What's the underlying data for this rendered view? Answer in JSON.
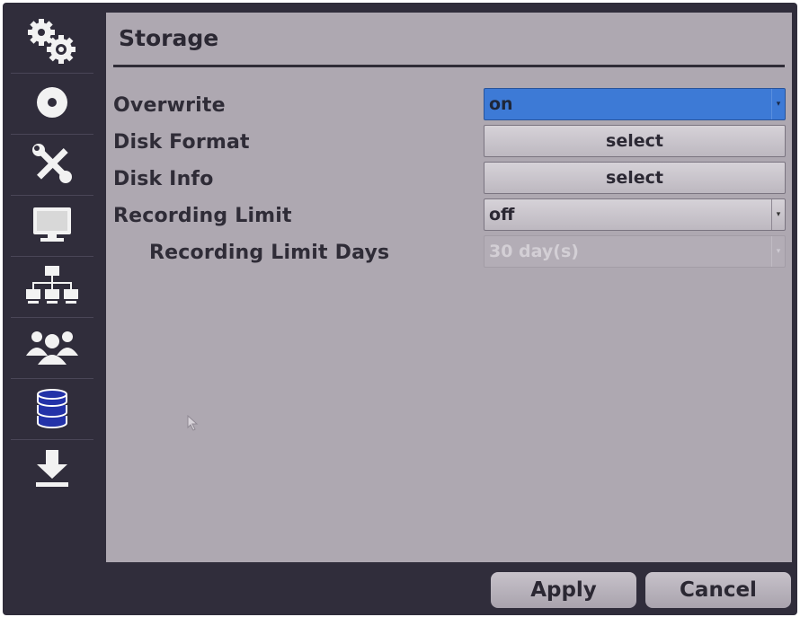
{
  "sidebar": {
    "items": [
      {
        "icon": "gears-icon"
      },
      {
        "icon": "disc-icon"
      },
      {
        "icon": "tools-icon"
      },
      {
        "icon": "monitor-icon"
      },
      {
        "icon": "network-icon"
      },
      {
        "icon": "users-icon"
      },
      {
        "icon": "database-icon"
      },
      {
        "icon": "download-icon"
      }
    ]
  },
  "panel": {
    "title": "Storage",
    "rows": [
      {
        "label": "Overwrite",
        "value": "on"
      },
      {
        "label": "Disk  Format",
        "value": "select"
      },
      {
        "label": "Disk  Info",
        "value": "select"
      },
      {
        "label": "Recording  Limit",
        "value": "off"
      },
      {
        "label": "Recording  Limit  Days",
        "value": "30  day(s)"
      }
    ]
  },
  "footer": {
    "apply_label": "Apply",
    "cancel_label": "Cancel"
  },
  "colors": {
    "frame": "#302d3b",
    "panel": "#aea8b1",
    "accent": "#3d7ad6",
    "database_icon": "#2332a8"
  }
}
